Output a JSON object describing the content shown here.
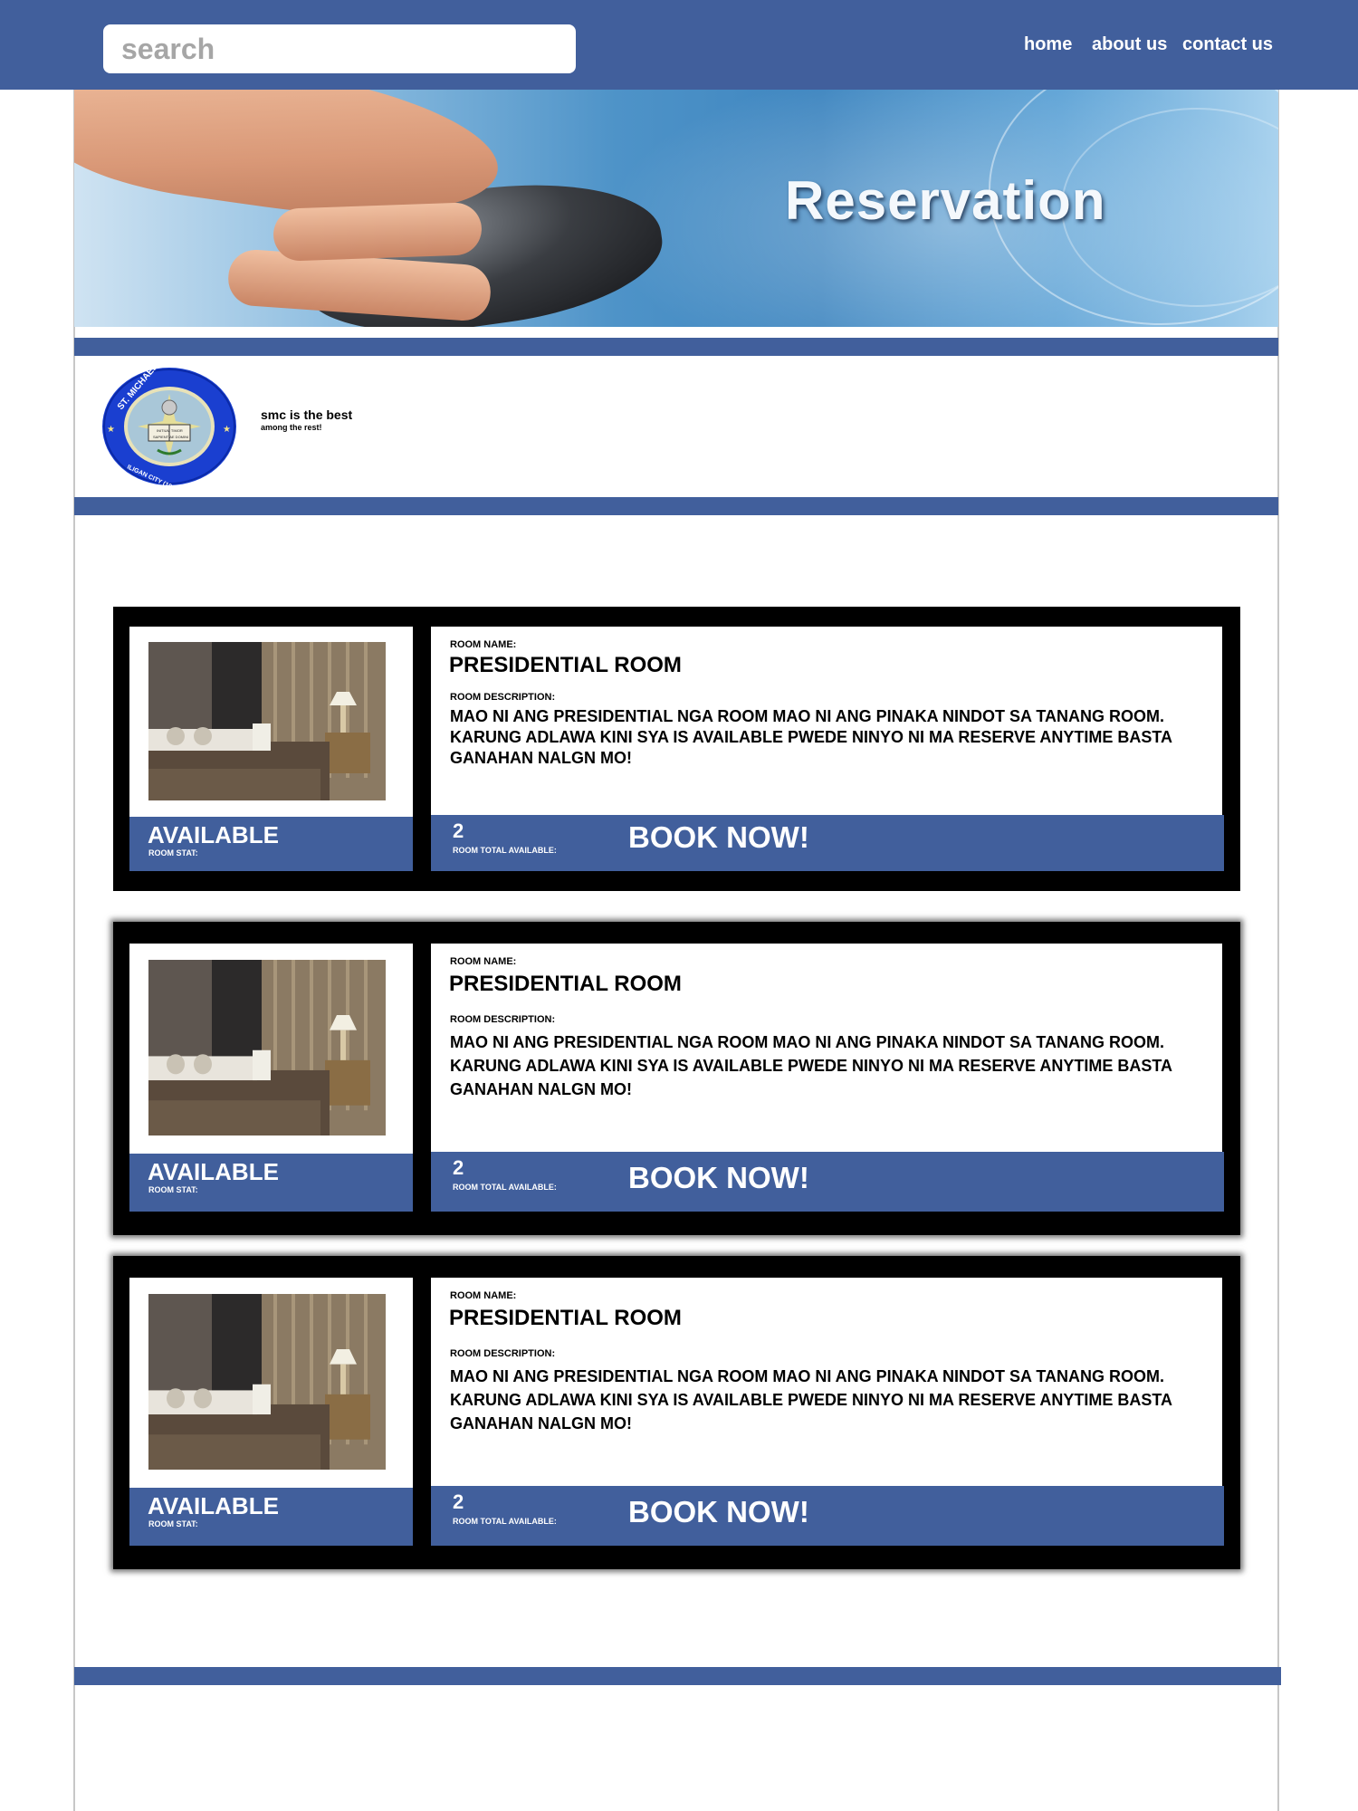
{
  "header": {
    "search_placeholder": "search",
    "nav": {
      "home": "home",
      "about": "about us",
      "contact": "contact us"
    }
  },
  "banner": {
    "title": "Reservation"
  },
  "brand": {
    "tagline": "smc is the best",
    "subtagline": "among the rest!",
    "logo_text_top": "ST. MICHAEL'S COLLEGE",
    "logo_text_bottom": "ILIGAN CITY (1914) PHILIPPINES",
    "logo_motto_1": "INITIUM TIMOR",
    "logo_motto_2": "SAPIENTIAE DOMINI"
  },
  "labels": {
    "room_name": "ROOM NAME:",
    "room_description": "ROOM DESCRIPTION:",
    "room_stat": "ROOM STAT:",
    "room_total": "ROOM TOTAL AVAILABLE:",
    "book": "BOOK NOW!"
  },
  "rooms": [
    {
      "name": "PRESIDENTIAL ROOM",
      "description": "MAO NI ANG PRESIDENTIAL NGA ROOM MAO NI ANG PINAKA NINDOT SA TANANG ROOM. KARUNG ADLAWA KINI SYA IS AVAILABLE PWEDE NINYO NI MA RESERVE ANYTIME BASTA GANAHAN NALGN MO!",
      "status": "AVAILABLE",
      "total": "2"
    },
    {
      "name": "PRESIDENTIAL ROOM",
      "description": "MAO NI ANG PRESIDENTIAL NGA ROOM MAO NI ANG PINAKA NINDOT SA TANANG ROOM. KARUNG ADLAWA KINI SYA IS AVAILABLE PWEDE NINYO NI MA RESERVE ANYTIME BASTA GANAHAN NALGN MO!",
      "status": "AVAILABLE",
      "total": "2"
    },
    {
      "name": "PRESIDENTIAL ROOM",
      "description": "MAO NI ANG PRESIDENTIAL NGA ROOM MAO NI ANG PINAKA NINDOT SA TANANG ROOM. KARUNG ADLAWA KINI SYA IS AVAILABLE PWEDE NINYO NI MA RESERVE ANYTIME BASTA GANAHAN NALGN MO!",
      "status": "AVAILABLE",
      "total": "2"
    }
  ],
  "colors": {
    "primary": "#415f9c",
    "card_bg": "#000000",
    "panel_bg": "#ffffff"
  }
}
